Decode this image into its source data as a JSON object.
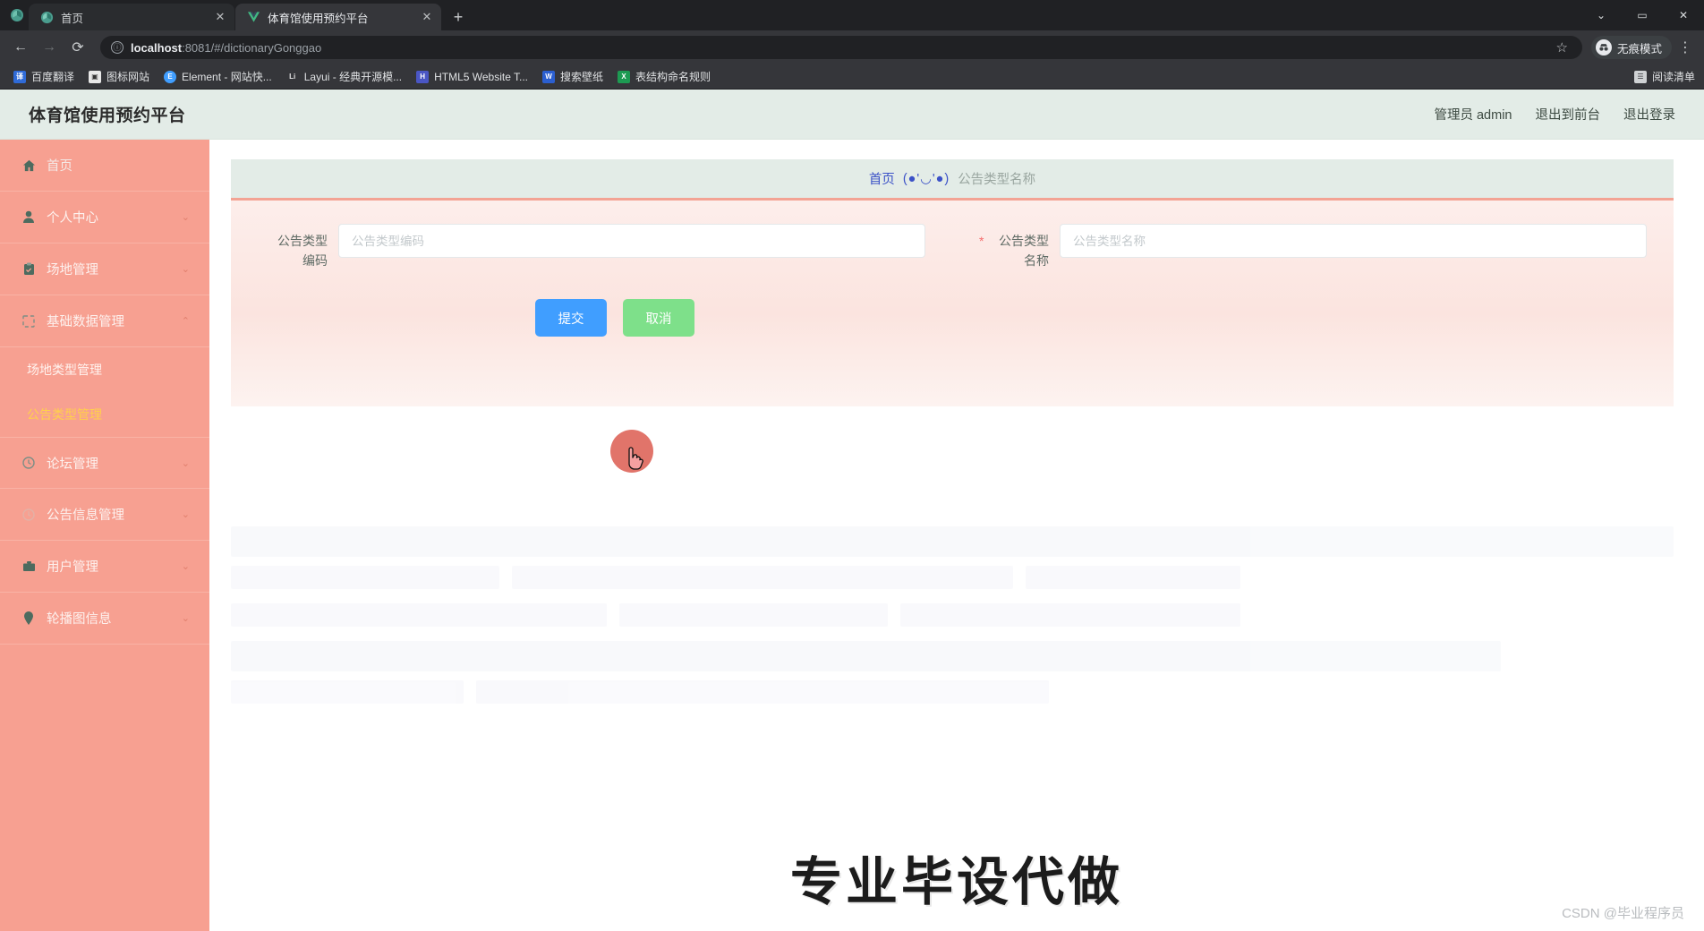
{
  "browser": {
    "tabs": [
      {
        "title": "首页",
        "active": false,
        "favicon": "globe-icon",
        "close": "✕"
      },
      {
        "title": "体育馆使用预约平台",
        "active": true,
        "favicon": "vue-icon",
        "close": "✕"
      }
    ],
    "new_tab_label": "+",
    "window_controls": {
      "minimize": "⌄",
      "maximize": "▭",
      "close": "✕"
    },
    "nav": {
      "back": "←",
      "forward": "→",
      "reload": "⟳"
    },
    "omnibox": {
      "info_icon": "ⓘ",
      "url_host": "localhost",
      "url_path": ":8081/#/dictionaryGonggao",
      "star_icon": "☆"
    },
    "incognito_label": "无痕模式",
    "kebab_label": "⋮",
    "bookmarks": [
      {
        "label": "百度翻译",
        "color": "#2f6bd8",
        "glyph": "译"
      },
      {
        "label": "图标网站",
        "color": "#e8e8e8",
        "glyph": "▣"
      },
      {
        "label": "Element - 网站快...",
        "color": "#409eff",
        "glyph": "E"
      },
      {
        "label": "Layui - 经典开源模...",
        "color": "#3a3a3a",
        "glyph": "Li"
      },
      {
        "label": "HTML5 Website T...",
        "color": "#4a56c4",
        "glyph": "H"
      },
      {
        "label": "搜索壁纸",
        "color": "#2b5fd0",
        "glyph": "W"
      },
      {
        "label": "表结构命名规则",
        "color": "#1d9a52",
        "glyph": "X"
      }
    ],
    "reading_list": {
      "icon": "list-icon",
      "label": "阅读清单"
    }
  },
  "app": {
    "title": "体育馆使用预约平台",
    "header_links": [
      {
        "label": "管理员 admin"
      },
      {
        "label": "退出到前台"
      },
      {
        "label": "退出登录"
      }
    ]
  },
  "sidebar": {
    "items": [
      {
        "label": "首页",
        "icon": "home-icon",
        "arrow": "",
        "children": []
      },
      {
        "label": "个人中心",
        "icon": "user-icon",
        "arrow": "⌄",
        "children": []
      },
      {
        "label": "场地管理",
        "icon": "clipboard-icon",
        "arrow": "⌄",
        "children": []
      },
      {
        "label": "基础数据管理",
        "icon": "database-icon",
        "arrow": "⌃",
        "children": [
          {
            "label": "场地类型管理",
            "active": false
          },
          {
            "label": "公告类型管理",
            "active": true
          }
        ]
      },
      {
        "label": "论坛管理",
        "icon": "clock-icon",
        "arrow": "⌄",
        "children": []
      },
      {
        "label": "公告信息管理",
        "icon": "bell-icon",
        "arrow": "⌄",
        "children": []
      },
      {
        "label": "用户管理",
        "icon": "briefcase-icon",
        "arrow": "⌄",
        "children": []
      },
      {
        "label": "轮播图信息",
        "icon": "pin-icon",
        "arrow": "⌄",
        "children": []
      }
    ]
  },
  "breadcrumb": {
    "home": "首页",
    "separator": "(●'◡'●)",
    "current": "公告类型名称"
  },
  "form": {
    "fields": [
      {
        "label_line1": "公告类型",
        "label_line2": "编码",
        "required": false,
        "required_mark": "",
        "value": "",
        "placeholder": "公告类型编码"
      },
      {
        "label_line1": "公告类型",
        "label_line2": "名称",
        "required": true,
        "required_mark": "*",
        "value": "",
        "placeholder": "公告类型名称"
      }
    ],
    "buttons": {
      "submit": "提交",
      "cancel": "取消"
    }
  },
  "watermark": {
    "text": "专业毕设代做",
    "credit": "CSDN @毕业程序员"
  },
  "colors": {
    "sidebar_bg": "#f7a091",
    "header_bg": "#e3ece7",
    "submit_blue": "#409eff",
    "cancel_green": "#7ee08a",
    "active_yellow": "#ffd04b",
    "breadcrumb_link": "#3b51c7",
    "cursor_red": "#d63e30"
  }
}
